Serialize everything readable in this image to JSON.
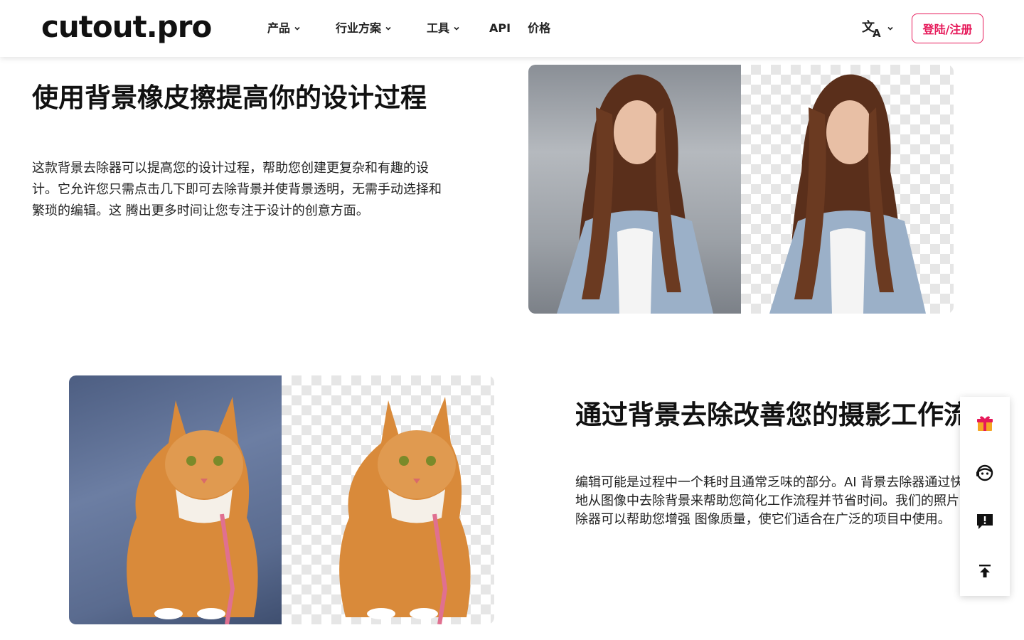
{
  "header": {
    "logo": "cutout.pro",
    "nav": [
      {
        "label": "产品",
        "has_dropdown": true
      },
      {
        "label": "行业方案",
        "has_dropdown": true
      },
      {
        "label": "工具",
        "has_dropdown": true
      },
      {
        "label": "API",
        "has_dropdown": false
      },
      {
        "label": "价格",
        "has_dropdown": false
      }
    ],
    "language_icon": "translate-icon",
    "login_label": "登陆/注册"
  },
  "section1": {
    "title": "使用背景橡皮擦提高你的设计过程",
    "description": "这款背景去除器可以提高您的设计过程，帮助您创建更复杂和有趣的设计。它允许您只需点击几下即可去除背景并使背景透明，无需手动选择和繁琐的编辑。这 腾出更多时间让您专注于设计的创意方面。",
    "image_subject": "woman"
  },
  "section2": {
    "title": "通过背景去除改善您的摄影工作流程",
    "description": "编辑可能是过程中一个耗时且通常乏味的部分。AI 背景去除器通过快速轻松地从图像中去除背景来帮助您简化工作流程并节省时间。我们的照片背景去除器可以帮助您增强 图像质量，使它们适合在广泛的项目中使用。",
    "image_subject": "cat"
  },
  "sidebar": {
    "buttons": [
      "gift-icon",
      "support-agent-icon",
      "feedback-icon",
      "back-to-top-icon"
    ]
  },
  "colors": {
    "accent": "#e6195a",
    "gift": "#f5a623",
    "text": "#111111"
  }
}
